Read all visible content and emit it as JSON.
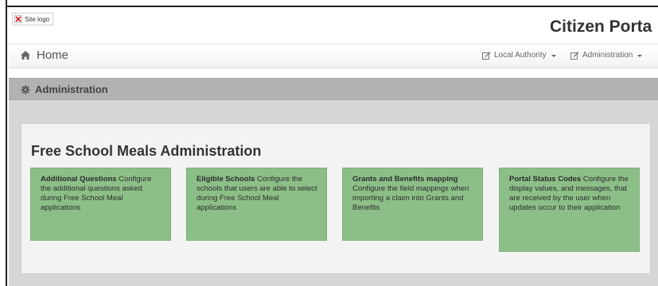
{
  "brand": {
    "logo_alt": "Site logo",
    "portal_title": "Citizen Porta"
  },
  "nav": {
    "home_label": "Home",
    "menus": [
      {
        "label": "Local Authority"
      },
      {
        "label": "Administration"
      }
    ]
  },
  "section": {
    "title": "Administration"
  },
  "panel": {
    "title": "Free School Meals Administration",
    "tiles": [
      {
        "heading": "Additional Questions",
        "description": "Configure the additional questions asked during Free School Meal applications"
      },
      {
        "heading": "Eligible Schools",
        "description": "Configure the schools that users are able to select during Free School Meal applications"
      },
      {
        "heading": "Grants and Benefits mapping",
        "description": "Configure the field mappings when importing a claim into Grants and Benefits"
      },
      {
        "heading": "Portal Status Codes",
        "description": "Configure the display values, and messages, that are received by the user when updates occur to their application"
      }
    ]
  }
}
